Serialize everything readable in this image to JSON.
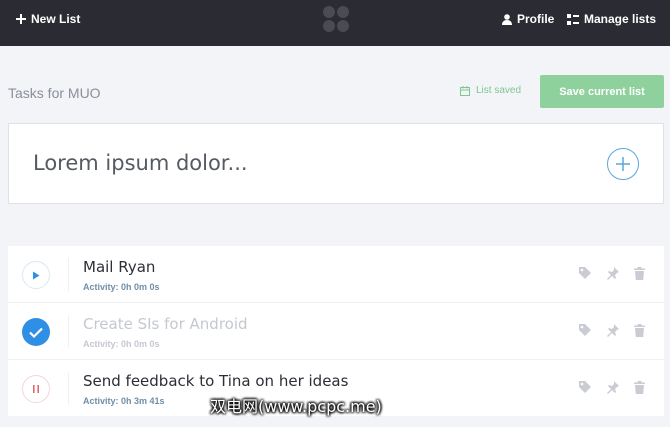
{
  "topbar": {
    "new_list_label": "New List",
    "profile_label": "Profile",
    "manage_lists_label": "Manage lists"
  },
  "header": {
    "list_title": "Tasks for MUO",
    "saved_status": "List saved",
    "save_button_label": "Save current list"
  },
  "task_input": {
    "placeholder": "Lorem ipsum dolor..."
  },
  "tasks": [
    {
      "name": "Mail Ryan",
      "activity": "Activity: 0h 0m 0s",
      "state": "play"
    },
    {
      "name": "Create SIs for Android",
      "activity": "Activity: 0h 0m 0s",
      "state": "done"
    },
    {
      "name": "Send feedback to Tina on her ideas",
      "activity": "Activity: 0h 3m 41s",
      "state": "pause"
    }
  ],
  "watermark": "双电网(www.pcpc.me)",
  "colors": {
    "topbar": "#2b2c33",
    "accent_green": "#8fd19d",
    "accent_blue": "#2f8fe4",
    "pause_red": "#e46a6a"
  }
}
